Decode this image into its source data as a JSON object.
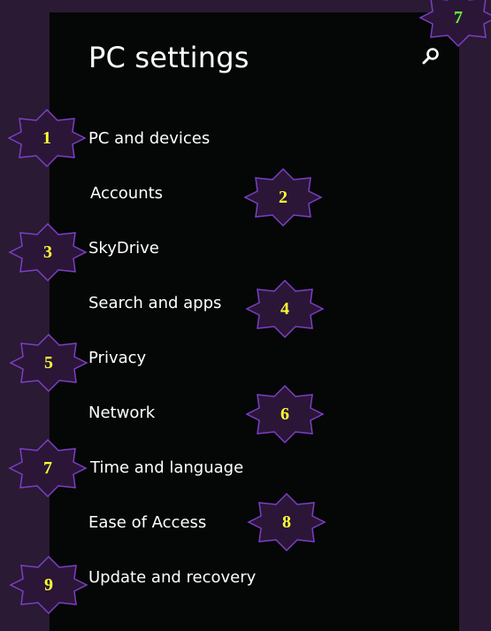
{
  "window": {
    "title": "PC settings"
  },
  "header": {
    "search_icon": "search-icon"
  },
  "menu": {
    "items": [
      {
        "label": "PC and devices"
      },
      {
        "label": "Accounts"
      },
      {
        "label": "SkyDrive"
      },
      {
        "label": "Search and apps"
      },
      {
        "label": "Privacy"
      },
      {
        "label": "Network"
      },
      {
        "label": "Time and language"
      },
      {
        "label": "Ease of Access"
      },
      {
        "label": "Update and recovery"
      }
    ]
  },
  "annotations": {
    "labels": [
      "1",
      "2",
      "3",
      "4",
      "5",
      "6",
      "7",
      "8",
      "9",
      "7"
    ],
    "fill": "#2b1638",
    "stroke": "#7b3fc4",
    "text_color": "#ffff33",
    "corner_text_color": "#66ff33"
  },
  "colors": {
    "background": "#2a1a33",
    "panel": "#050606",
    "text": "#ffffff"
  }
}
